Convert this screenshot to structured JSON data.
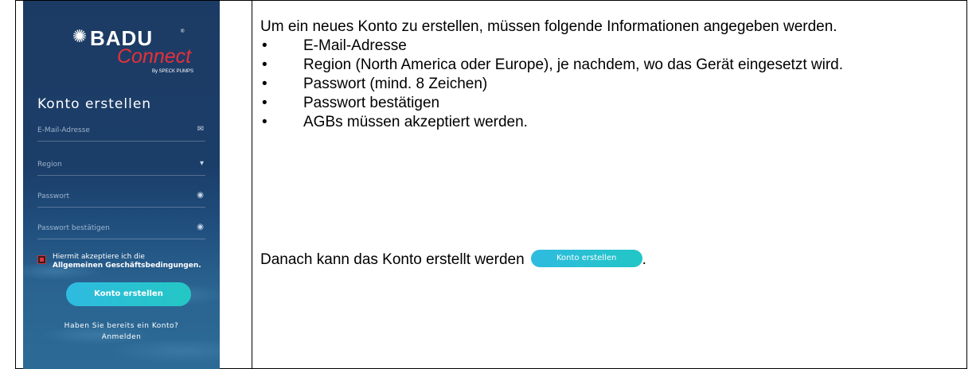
{
  "app": {
    "logo_brand": "BADU",
    "logo_tm": "®",
    "logo_product": "Connect",
    "logo_by": "By SPECK PUMPS",
    "title": "Konto erstellen",
    "fields": [
      {
        "label": "E-Mail-Adresse",
        "icon": "envelope-icon",
        "glyph": "✉"
      },
      {
        "label": "Region",
        "icon": "caret-down-icon",
        "glyph": "▾"
      },
      {
        "label": "Passwort",
        "icon": "eye-icon",
        "glyph": "◉"
      },
      {
        "label": "Passwort bestätigen",
        "icon": "eye-icon",
        "glyph": "◉"
      }
    ],
    "agb_line1": "Hiermit akzeptiere ich die",
    "agb_line2": "Allgemeinen Geschäftsbedingungen.",
    "button_label": "Konto erstellen",
    "login_question": "Haben Sie bereits ein Konto?",
    "login_link": "Anmelden",
    "accent_color": "#2fbbe0",
    "checkbox_color": "#d83b3b"
  },
  "description": {
    "intro": "Um ein neues Konto zu erstellen, müssen folgende Informationen angegeben werden.",
    "bullet_glyph": "•",
    "requirements": [
      "E-Mail-Adresse",
      "Region (North America oder Europe), je nachdem, wo das Gerät eingesetzt wird.",
      "Passwort (mind. 8 Zeichen)",
      "Passwort bestätigen",
      "AGBs müssen akzeptiert werden."
    ],
    "after_text": "Danach kann das Konto erstellt werden",
    "after_button": "Konto erstellen",
    "after_period": "."
  }
}
